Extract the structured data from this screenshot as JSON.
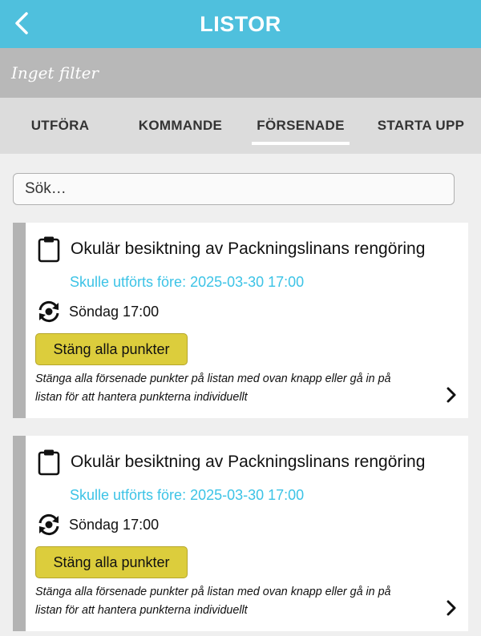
{
  "header": {
    "title": "LISTOR",
    "background": "#4fc0dd"
  },
  "filter": {
    "label": "Inget filter"
  },
  "tabs": [
    {
      "label": "UTFÖRA",
      "active": false
    },
    {
      "label": "KOMMANDE",
      "active": false
    },
    {
      "label": "FÖRSENADE",
      "active": true
    },
    {
      "label": "STARTA UPP",
      "active": false
    }
  ],
  "search": {
    "placeholder": "Sök…",
    "value": ""
  },
  "cards": [
    {
      "title": "Okulär besiktning av Packningslinans rengöring",
      "due": "Skulle utförts före: 2025-03-30 17:00",
      "schedule": "Söndag 17:00",
      "button_label": "Stäng alla punkter",
      "hint": "Stänga alla försenade punkter på listan med ovan knapp eller gå in på listan för att hantera punkterna individuellt",
      "icon": "clipboard-icon",
      "schedule_icon": "repeat-icon"
    },
    {
      "title": "Okulär besiktning av Packningslinans rengöring",
      "due": "Skulle utförts före: 2025-03-30 17:00",
      "schedule": "Söndag 17:00",
      "button_label": "Stäng alla punkter",
      "hint": "Stänga alla försenade punkter på listan med ovan knapp eller gå in på listan för att hantera punkterna individuellt",
      "icon": "clipboard-icon",
      "schedule_icon": "repeat-icon"
    }
  ],
  "colors": {
    "accent": "#4fc0dd",
    "due_text": "#3cc3e6",
    "button": "#dccd3c"
  }
}
